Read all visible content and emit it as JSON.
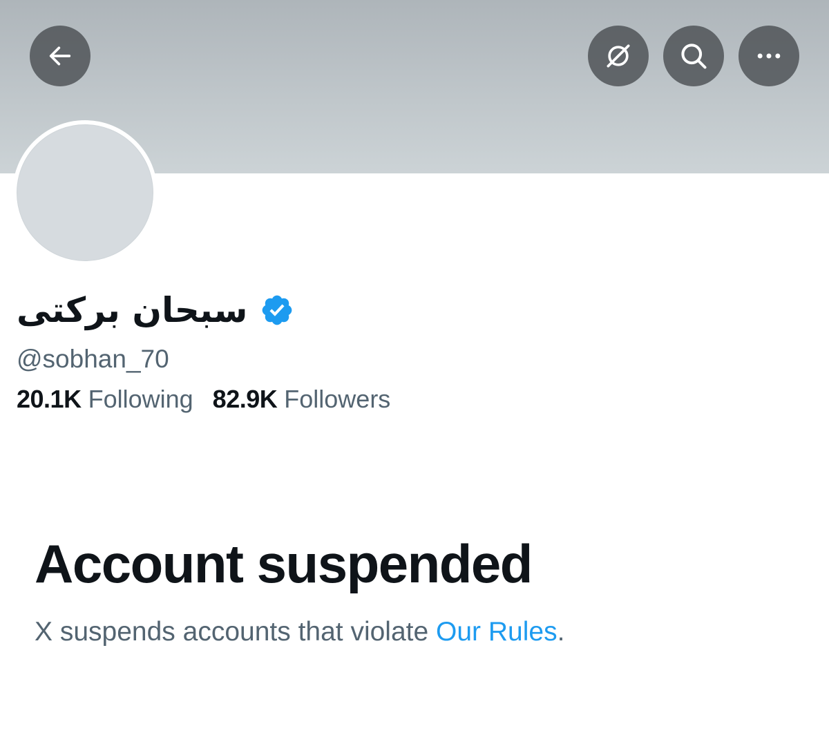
{
  "profile": {
    "display_name": "سبحان برکتی",
    "handle": "@sobhan_70",
    "verified": true,
    "following_count": "20.1K",
    "following_label": "Following",
    "followers_count": "82.9K",
    "followers_label": "Followers"
  },
  "header": {
    "icons": [
      "back-arrow-icon",
      "grok-icon",
      "search-icon",
      "more-dots-icon"
    ]
  },
  "suspension": {
    "title": "Account suspended",
    "description_prefix": "X suspends accounts that violate ",
    "link_text": "Our Rules",
    "description_suffix": "."
  },
  "colors": {
    "text_primary": "#0f1419",
    "text_secondary": "#536471",
    "link": "#1d9bf0",
    "verified_badge": "#1d9bf0"
  }
}
